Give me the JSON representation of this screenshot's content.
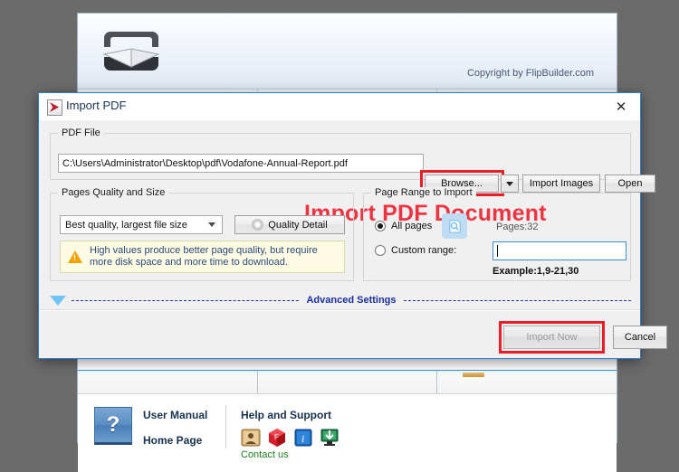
{
  "app": {
    "copyright": "Copyright by FlipBuilder.com",
    "logo_icon": "open-book-logo",
    "footer": {
      "help_icon": "question-mark-icon",
      "user_manual_label": "User Manual",
      "home_page_label": "Home Page",
      "help_title": "Help and Support",
      "contact_label": "Contact us",
      "icons": [
        "contact-card-icon",
        "flipbuilder-cube-icon",
        "info-icon",
        "download-monitor-icon"
      ]
    }
  },
  "dialog": {
    "title": "Import PDF",
    "title_icon": "pdf-file-icon",
    "close_icon": "close-icon",
    "pdf_file": {
      "legend": "PDF File",
      "path_value": "C:\\Users\\Administrator\\Desktop\\pdf\\Vodafone-Annual-Report.pdf",
      "browse_label": "Browse...",
      "dropdown_icon": "chevron-down-icon",
      "import_images_label": "Import Images",
      "open_label": "Open"
    },
    "quality": {
      "legend": "Pages Quality and Size",
      "selected_option": "Best quality, largest file size",
      "quality_detail_label": "Quality Detail",
      "quality_detail_icon": "gear-icon",
      "warning_icon": "warning-triangle-icon",
      "warning_line1": "High values produce better page quality, but require",
      "warning_line2": "more disk space and more time to download."
    },
    "page_range": {
      "legend": "Page Range to Import",
      "all_pages_label": "All pages",
      "custom_range_label": "Custom range:",
      "preview_icon": "page-preview-icon",
      "pages_count": "Pages:32",
      "custom_range_value": "",
      "example_text": "Example:1,9-21,30"
    },
    "advanced": {
      "label": "Advanced Settings",
      "toggle_icon": "triangle-down-icon"
    },
    "footer": {
      "import_now_label": "Import Now",
      "cancel_label": "Cancel"
    }
  },
  "annotation": {
    "heading_text": "Import PDF Document",
    "heading_color": "#ef3340",
    "highlight_color": "#ee1c24"
  }
}
